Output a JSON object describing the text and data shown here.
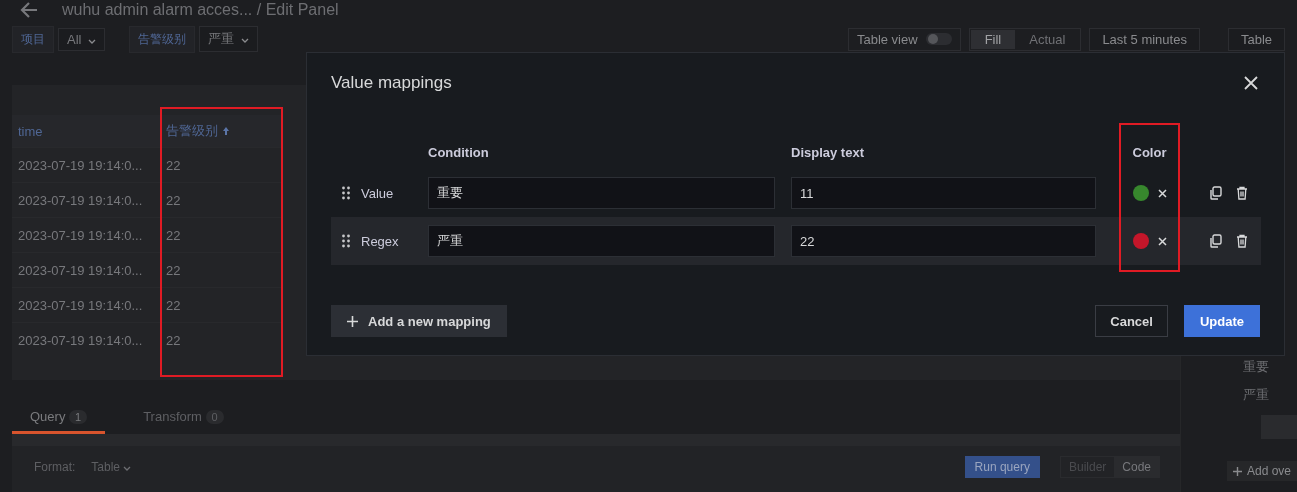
{
  "header": {
    "title": "wuhu admin alarm acces... / Edit Panel"
  },
  "variables": [
    {
      "label": "项目",
      "value": "All"
    },
    {
      "label": "告警级别",
      "value": "严重"
    }
  ],
  "toolbar": {
    "table_view": {
      "label": "Table view",
      "on": false
    },
    "display_modes": [
      {
        "label": "Fill",
        "selected": true
      },
      {
        "label": "Actual",
        "selected": false
      }
    ],
    "time_range": "Last 5 minutes",
    "visualization": "Table"
  },
  "table": {
    "columns": [
      {
        "label": "time",
        "sorted": false,
        "highlighted": false
      },
      {
        "label": "告警级别",
        "sorted": true,
        "highlighted": true
      }
    ],
    "rows": [
      [
        "2023-07-19 19:14:0...",
        "22"
      ],
      [
        "2023-07-19 19:14:0...",
        "22"
      ],
      [
        "2023-07-19 19:14:0...",
        "22"
      ],
      [
        "2023-07-19 19:14:0...",
        "22"
      ],
      [
        "2023-07-19 19:14:0...",
        "22"
      ],
      [
        "2023-07-19 19:14:0...",
        "22"
      ]
    ]
  },
  "query_tabs": [
    {
      "label": "Query",
      "count": "1",
      "selected": true
    },
    {
      "label": "Transform",
      "count": "0",
      "selected": false
    }
  ],
  "query_editor": {
    "format_label": "Format:",
    "format_value": "Table",
    "run_button": "Run query",
    "modes": [
      {
        "label": "Builder",
        "selected": false
      },
      {
        "label": "Code",
        "selected": true
      }
    ]
  },
  "sidebar": {
    "values": [
      "重要",
      "严重"
    ],
    "add_button": "Add ove"
  },
  "modal": {
    "title": "Value mappings",
    "column_headers": [
      "Condition",
      "Display text",
      "Color"
    ],
    "color_highlighted": true,
    "mappings": [
      {
        "type": "Value",
        "condition": "重要",
        "display": "11",
        "color": "#37872d",
        "highlighted": false
      },
      {
        "type": "Regex",
        "condition": "严重",
        "display": "22",
        "color": "#c4162a",
        "highlighted": true
      }
    ],
    "add_button": "Add a new mapping",
    "cancel": "Cancel",
    "update": "Update"
  }
}
